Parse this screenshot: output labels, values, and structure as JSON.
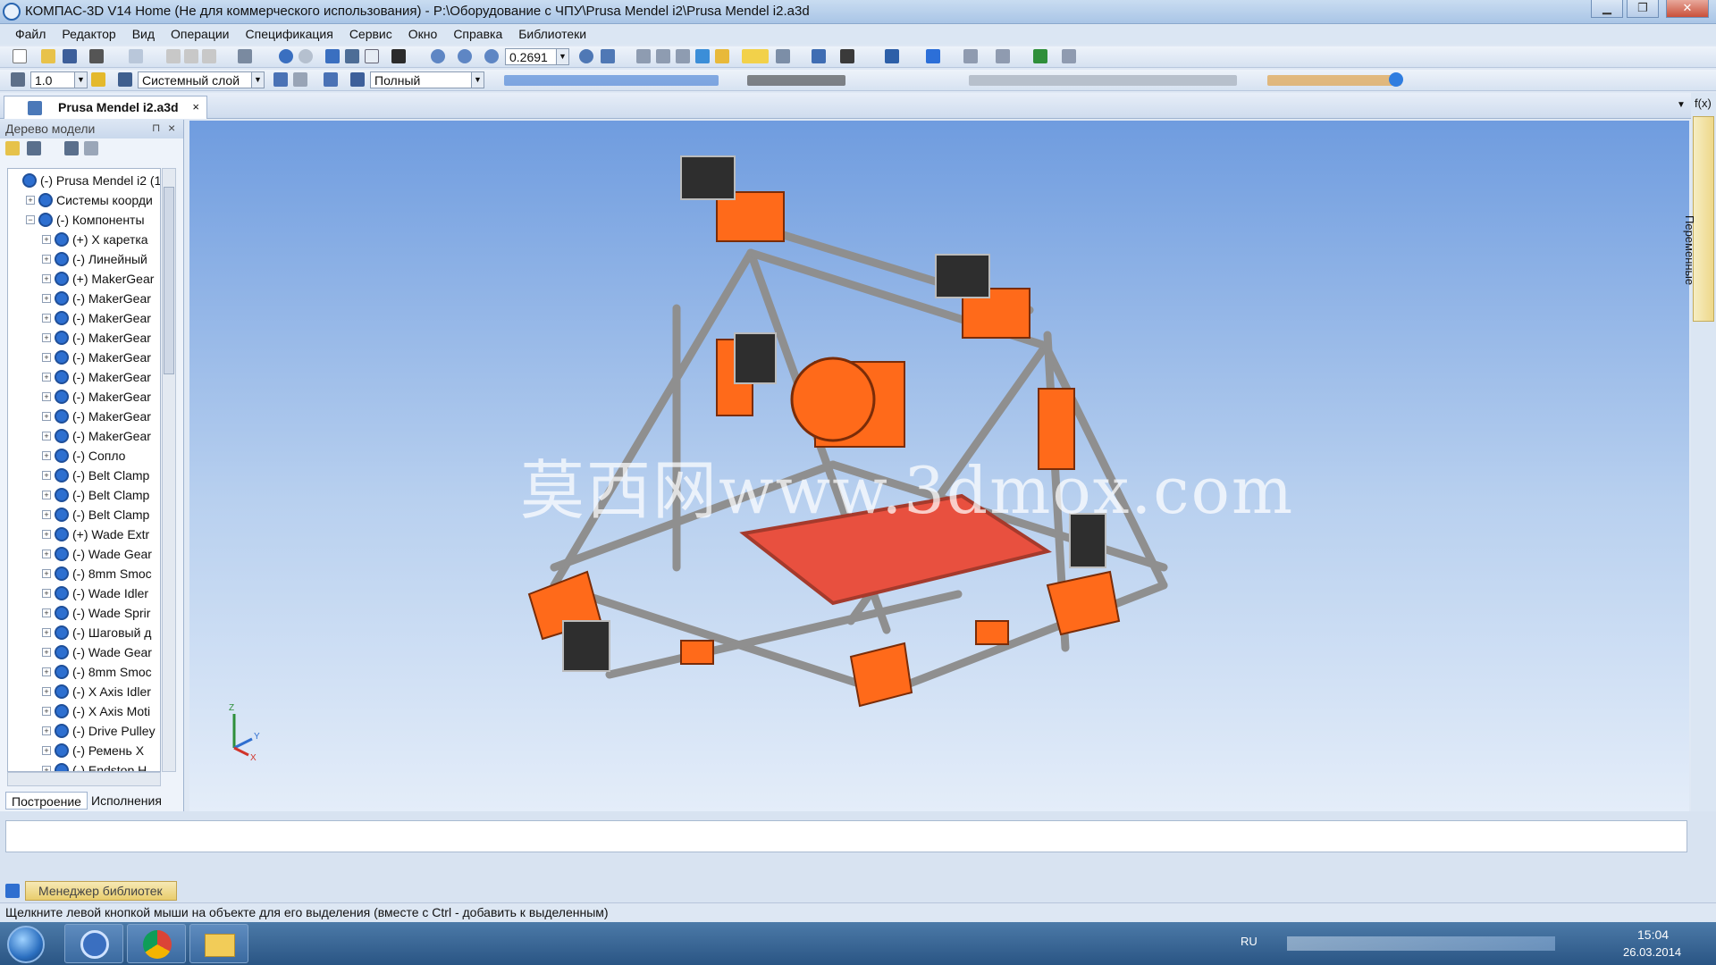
{
  "window": {
    "title": "КОМПАС-3D V14 Home (Не для коммерческого использования) - P:\\Оборудование с ЧПУ\\Prusa Mendel i2\\Prusa Mendel i2.a3d"
  },
  "menu": [
    "Файл",
    "Редактор",
    "Вид",
    "Операции",
    "Спецификация",
    "Сервис",
    "Окно",
    "Справка",
    "Библиотеки"
  ],
  "toolbar": {
    "zoom_value": "0.2691",
    "step_value": "1.0",
    "layer_value": "Системный слой",
    "view_mode_value": "Полный"
  },
  "doc_tab": {
    "label": "Prusa Mendel i2.a3d",
    "close": "×"
  },
  "tree_panel": {
    "title": "Дерево модели",
    "pin": "⊓",
    "close": "×",
    "items": [
      {
        "label": "(-) Prusa Mendel i2 (1",
        "level": 0,
        "expander": ""
      },
      {
        "label": "Системы коорди",
        "level": 1,
        "expander": "+"
      },
      {
        "label": "(-) Компоненты",
        "level": 1,
        "expander": "−"
      },
      {
        "label": "(+) X каретка",
        "level": 2,
        "expander": "+"
      },
      {
        "label": "(-) Линейный",
        "level": 2,
        "expander": "+"
      },
      {
        "label": "(+) MakerGear",
        "level": 2,
        "expander": "+"
      },
      {
        "label": "(-) MakerGear",
        "level": 2,
        "expander": "+"
      },
      {
        "label": "(-) MakerGear",
        "level": 2,
        "expander": "+"
      },
      {
        "label": "(-) MakerGear",
        "level": 2,
        "expander": "+"
      },
      {
        "label": "(-) MakerGear",
        "level": 2,
        "expander": "+"
      },
      {
        "label": "(-) MakerGear",
        "level": 2,
        "expander": "+"
      },
      {
        "label": "(-) MakerGear",
        "level": 2,
        "expander": "+"
      },
      {
        "label": "(-) MakerGear",
        "level": 2,
        "expander": "+"
      },
      {
        "label": "(-) MakerGear",
        "level": 2,
        "expander": "+"
      },
      {
        "label": "(-) Сопло",
        "level": 2,
        "expander": "+"
      },
      {
        "label": "(-) Belt Clamp",
        "level": 2,
        "expander": "+"
      },
      {
        "label": "(-) Belt Clamp",
        "level": 2,
        "expander": "+"
      },
      {
        "label": "(-) Belt Clamp",
        "level": 2,
        "expander": "+"
      },
      {
        "label": "(+) Wade Extr",
        "level": 2,
        "expander": "+"
      },
      {
        "label": "(-) Wade Gear",
        "level": 2,
        "expander": "+"
      },
      {
        "label": "(-) 8mm Smoc",
        "level": 2,
        "expander": "+"
      },
      {
        "label": "(-) Wade Idler",
        "level": 2,
        "expander": "+"
      },
      {
        "label": "(-) Wade Sprir",
        "level": 2,
        "expander": "+"
      },
      {
        "label": "(-) Шаговый д",
        "level": 2,
        "expander": "+"
      },
      {
        "label": "(-) Wade Gear",
        "level": 2,
        "expander": "+"
      },
      {
        "label": "(-) 8mm Smoc",
        "level": 2,
        "expander": "+"
      },
      {
        "label": "(-) X Axis Idler",
        "level": 2,
        "expander": "+"
      },
      {
        "label": "(-) X Axis Moti",
        "level": 2,
        "expander": "+"
      },
      {
        "label": "(-) Drive Pulley",
        "level": 2,
        "expander": "+"
      },
      {
        "label": "(-) Ремень X",
        "level": 2,
        "expander": "+"
      },
      {
        "label": "(-) Endstop H",
        "level": 2,
        "expander": "+"
      }
    ],
    "tabs": [
      "Построение",
      "Исполнения"
    ]
  },
  "viewport": {
    "watermark": "莫西网www.3dmox.com",
    "axis_labels": {
      "x": "X",
      "y": "Y",
      "z": "Z"
    }
  },
  "right_panel": {
    "fx_label": "f(x)",
    "vertical_tab": "Переменные"
  },
  "library_button": "Менеджер библиотек",
  "status_text": "Щелкните левой кнопкой мыши на объекте для его выделения (вместе с Ctrl - добавить к выделенным)",
  "taskbar": {
    "lang": "RU",
    "time": "15:04",
    "date": "26.03.2014"
  },
  "colors": {
    "printed_parts": "#ff6a1a",
    "frame_rods": "#9a9a9a",
    "bed": "#e8503f",
    "viewport_top": "#6f9cdf",
    "viewport_bottom": "#e4edf9"
  }
}
